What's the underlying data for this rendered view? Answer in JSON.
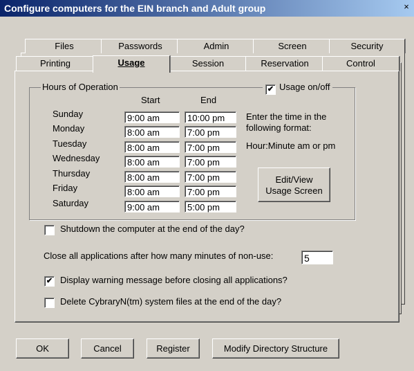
{
  "window": {
    "title": "Configure computers for the EIN branch and Adult group",
    "close_glyph": "×"
  },
  "tabs_row1": [
    "Files",
    "Passwords",
    "Admin",
    "Screen",
    "Security"
  ],
  "tabs_row2": [
    "Printing",
    "Usage",
    "Session",
    "Reservation",
    "Control"
  ],
  "active_tab": "Usage",
  "hours": {
    "legend": "Hours of Operation",
    "start_header": "Start",
    "end_header": "End",
    "days": [
      {
        "day": "Sunday",
        "start": "9:00 am",
        "end": "10:00 pm"
      },
      {
        "day": "Monday",
        "start": "8:00 am",
        "end": "7:00 pm"
      },
      {
        "day": "Tuesday",
        "start": "8:00 am",
        "end": "7:00 pm"
      },
      {
        "day": "Wednesday",
        "start": "8:00 am",
        "end": "7:00 pm"
      },
      {
        "day": "Thursday",
        "start": "8:00 am",
        "end": "7:00 pm"
      },
      {
        "day": "Friday",
        "start": "8:00 am",
        "end": "7:00 pm"
      },
      {
        "day": "Saturday",
        "start": "9:00 am",
        "end": "5:00 pm"
      }
    ],
    "usage_toggle": {
      "label": "Usage on/off",
      "checked": true
    },
    "hint_line1": "Enter the time in the",
    "hint_line2": "following format:",
    "hint_format": "Hour:Minute am or pm",
    "edit_button_line1": "Edit/View",
    "edit_button_line2": "Usage Screen"
  },
  "options": {
    "shutdown": {
      "label": "Shutdown the computer at the end of the day?",
      "checked": false
    },
    "close_apps_label": "Close all applications after how many minutes of non-use:",
    "close_apps_value": "5",
    "warning": {
      "label": "Display warning message before closing all applications?",
      "checked": true
    },
    "delete_files": {
      "label": "Delete CybraryN(tm) system files at the end of the day?",
      "checked": false
    }
  },
  "buttons": {
    "ok": "OK",
    "cancel": "Cancel",
    "register": "Register",
    "modify": "Modify Directory Structure"
  }
}
